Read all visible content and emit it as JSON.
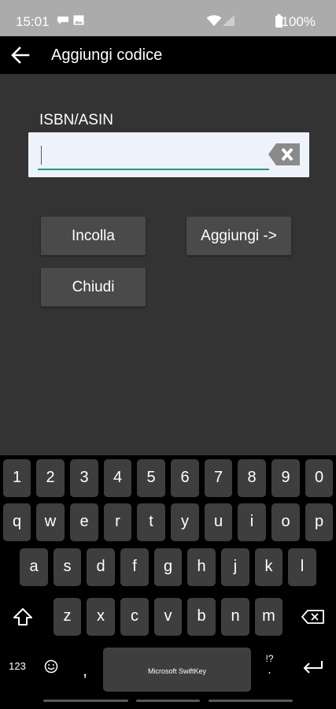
{
  "status_bar": {
    "time": "15:01",
    "battery": "100%",
    "icons": [
      "message-icon",
      "image-icon",
      "wifi-icon",
      "signal-icon",
      "battery-icon"
    ]
  },
  "app_bar": {
    "title": "Aggiungi codice",
    "back_icon": "arrow-left-icon"
  },
  "form": {
    "label": "ISBN/ASIN",
    "input_value": "",
    "clear_icon": "backspace-clear-icon",
    "buttons": {
      "paste": "Incolla",
      "add": "Aggiungi ->",
      "close": "Chiudi"
    }
  },
  "keyboard": {
    "row_numbers": [
      "1",
      "2",
      "3",
      "4",
      "5",
      "6",
      "7",
      "8",
      "9",
      "0"
    ],
    "row_1": [
      "q",
      "w",
      "e",
      "r",
      "t",
      "y",
      "u",
      "i",
      "o",
      "p"
    ],
    "row_2": [
      "a",
      "s",
      "d",
      "f",
      "g",
      "h",
      "j",
      "k",
      "l"
    ],
    "row_3": [
      "z",
      "x",
      "c",
      "v",
      "b",
      "n",
      "m"
    ],
    "symbols_key": "123",
    "comma_key": ",",
    "space_label": "Microsoft SwiftKey",
    "punct_top": "!?",
    "punct_bottom": ".",
    "icons": [
      "shift-icon",
      "backspace-icon",
      "emoji-icon",
      "enter-icon"
    ]
  },
  "colors": {
    "background": "#333333",
    "status_bar": "#ababab",
    "app_bar": "#000000",
    "input_bg": "#eef3fb",
    "input_underline": "#199c8f",
    "button_bg": "#4a4a4a",
    "key_bg": "#3e3e3e"
  }
}
